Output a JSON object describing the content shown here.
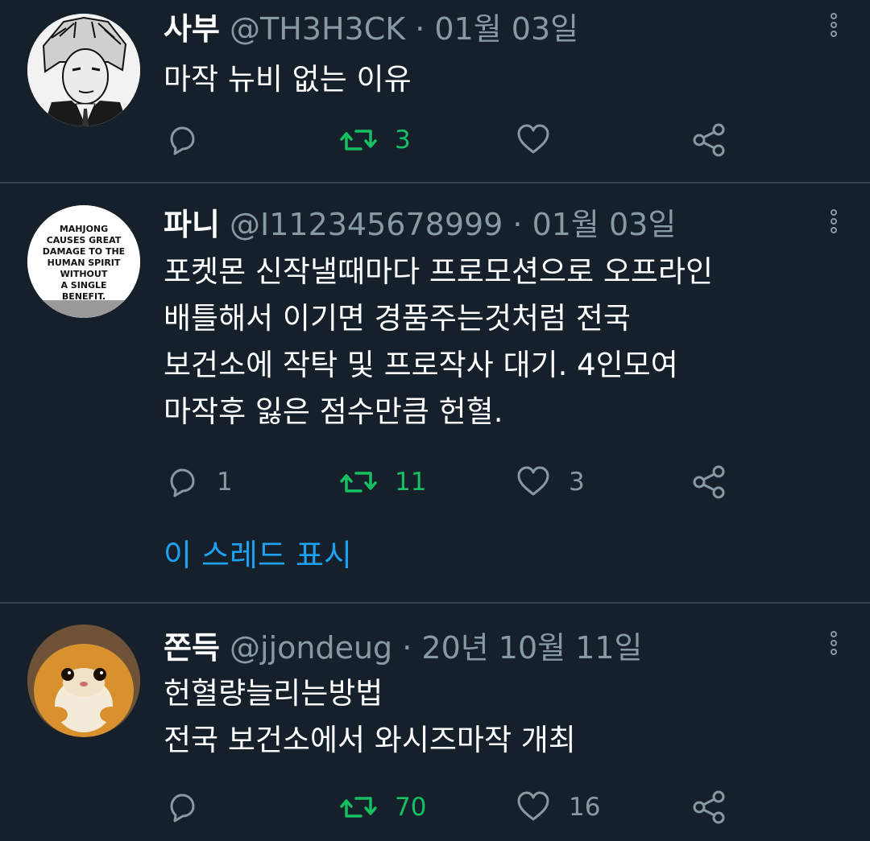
{
  "tweets": [
    {
      "name": "사부",
      "meta": "@TH3H3CK · 01월 03일",
      "lines": [
        "마작 뉴비 없는 이유"
      ],
      "reply_count": "",
      "retweet_count": "3",
      "like_count": ""
    },
    {
      "name": "파니",
      "meta": "@I112345678999 · 01월 03일",
      "lines": [
        "포켓몬 신작낼때마다 프로모션으로 오프라인",
        "배틀해서 이기면 경품주는것처럼 전국",
        "보건소에 작탁 및 프로작사 대기. 4인모여",
        "마작후 잃은 점수만큼 헌혈."
      ],
      "reply_count": "1",
      "retweet_count": "11",
      "like_count": "3",
      "avatar_text": [
        "MAHJONG",
        "CAUSES GREAT",
        "DAMAGE TO THE",
        "HUMAN SPIRIT",
        "WITHOUT",
        "A SINGLE",
        "BENEFIT."
      ]
    },
    {
      "name": "쫀득",
      "meta": "@jjondeug · 20년 10월 11일",
      "lines": [
        "헌혈량늘리는방법",
        "전국 보건소에서 와시즈마작 개최"
      ],
      "reply_count": "",
      "retweet_count": "70",
      "like_count": "16"
    }
  ],
  "thread_link": "이 스레드 표시",
  "colors": {
    "background": "#15202b",
    "divider": "#38444d",
    "muted": "#8899a6",
    "retweet_green": "#17bf63",
    "link_blue": "#1da1f2"
  },
  "icons": [
    "reply-icon",
    "retweet-icon",
    "like-icon",
    "share-icon",
    "more-icon"
  ]
}
